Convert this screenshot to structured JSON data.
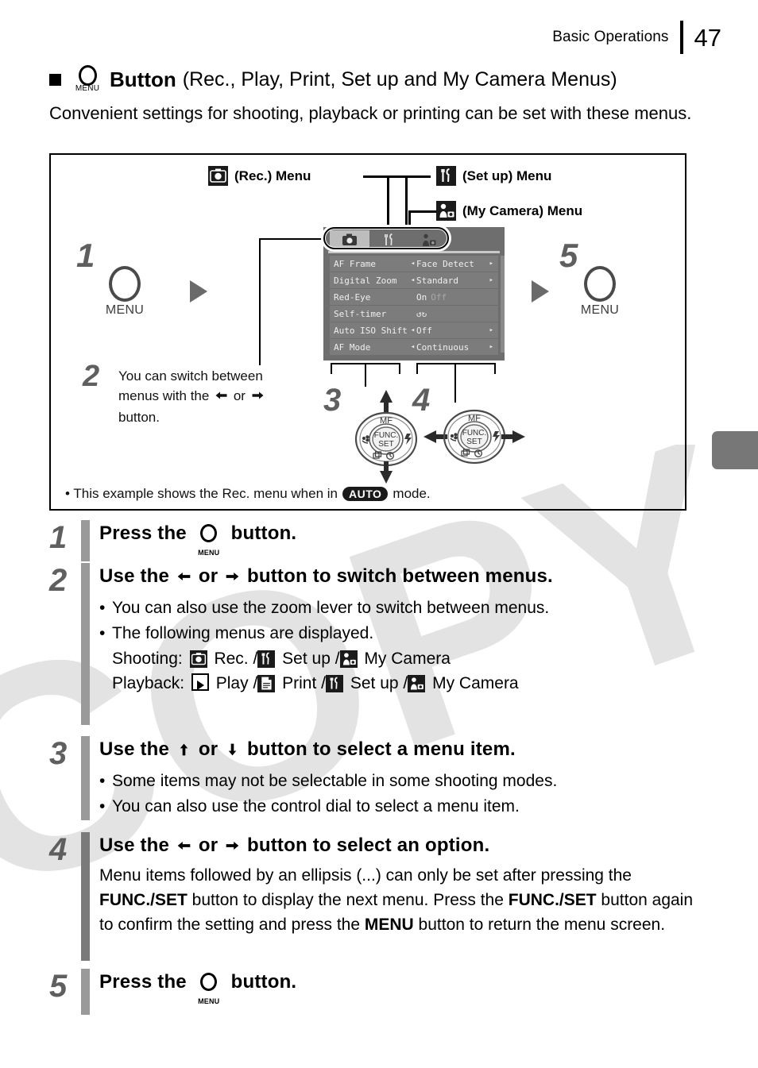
{
  "header": {
    "section_title": "Basic Operations",
    "page_number": "47"
  },
  "section": {
    "bullet_icon": "black-square",
    "button_icon_label": "MENU",
    "title_bold": "Button",
    "title_rest": "(Rec., Play, Print, Set up and My Camera Menus)",
    "lede": "Convenient settings for shooting, playback or printing can be set with these menus."
  },
  "diagram": {
    "callouts": [
      {
        "icon": "rec-camera-icon",
        "label": "(Rec.) Menu"
      },
      {
        "icon": "setup-tools-icon",
        "label": "(Set up) Menu"
      },
      {
        "icon": "my-camera-icon",
        "label": "(My Camera) Menu"
      }
    ],
    "step1_number": "1",
    "step1_button": "MENU",
    "step5_number": "5",
    "step5_button": "MENU",
    "step2_number": "2",
    "step2_text_line1": "You can switch between",
    "step2_text_line2_a": "menus with the",
    "step2_text_line2_or": "or",
    "step2_text_line3": "button.",
    "step3_number": "3",
    "step4_number": "4",
    "footnote_a": "• This example shows the Rec. menu when in",
    "footnote_badge": "AUTO",
    "footnote_b": "mode.",
    "lcd": {
      "tabs": [
        {
          "name": "rec-tab",
          "selected": true
        },
        {
          "name": "setup-tab",
          "selected": false
        },
        {
          "name": "my-camera-tab",
          "selected": false
        }
      ],
      "rows": [
        {
          "name": "AF Frame",
          "left_arrow": "◂",
          "value": "Face Detect",
          "value_dim": "",
          "right_arrow": "▸"
        },
        {
          "name": "Digital Zoom",
          "left_arrow": "◂",
          "value": "Standard",
          "value_dim": "",
          "right_arrow": "▸"
        },
        {
          "name": "Red-Eye",
          "left_arrow": "",
          "value": "On",
          "value_dim": "Off",
          "right_arrow": ""
        },
        {
          "name": "Self-timer",
          "left_arrow": "",
          "value": "↺↻",
          "value_dim": "",
          "right_arrow": ""
        },
        {
          "name": "Auto ISO Shift",
          "left_arrow": "◂",
          "value": "Off",
          "value_dim": "",
          "right_arrow": "▸"
        },
        {
          "name": "AF Mode",
          "left_arrow": "◂",
          "value": "Continuous",
          "value_dim": "",
          "right_arrow": "▸"
        }
      ]
    },
    "dial": {
      "top_label": "MF",
      "center_line1": "FUNC.",
      "center_line2": "SET"
    }
  },
  "steps": [
    {
      "number": "1",
      "title_a": "Press the",
      "title_icon": "MENU",
      "title_b": "button.",
      "bullets": []
    },
    {
      "number": "2",
      "title_a": "Use the",
      "title_or": "or",
      "title_b": "button to switch between menus.",
      "bullets": [
        "You can also use the zoom lever to switch between menus."
      ],
      "bullet2_head": "The following menus are displayed.",
      "shooting_label": "Shooting:",
      "shooting_items": [
        "Rec.",
        "Set up",
        "My Camera"
      ],
      "playback_label": "Playback:",
      "playback_items": [
        "Play",
        "Print",
        "Set up",
        "My Camera"
      ],
      "separator": "/"
    },
    {
      "number": "3",
      "title_a": "Use the",
      "title_or": "or",
      "title_b": "button to select a menu item.",
      "bullets": [
        "Some items may not be selectable in some shooting modes.",
        "You can also use the control dial to select a menu item."
      ]
    },
    {
      "number": "4",
      "title_a": "Use the",
      "title_or": "or",
      "title_b": "button to select an option.",
      "paragraph_1": "Menu items followed by an ellipsis (...) can only be set after pressing the ",
      "paragraph_bold_1": "FUNC./SET",
      "paragraph_2": " button to display the next menu. Press the ",
      "paragraph_bold_2": "FUNC./SET",
      "paragraph_3": " button again to confirm the setting and press the ",
      "paragraph_bold_3": "MENU",
      "paragraph_4": " button to return the menu screen."
    },
    {
      "number": "5",
      "title_a": "Press the",
      "title_icon": "MENU",
      "title_b": "button."
    }
  ],
  "watermark": {
    "text": "COPY"
  },
  "colors": {
    "step_bar": "#9a9a9a",
    "step_number": "#5f5f5f",
    "lcd_background": "#6e6e6e",
    "lcd_row": "#7c7c7c",
    "lcd_tab_selected": "#bdbdbd",
    "edge_tab": "#777777",
    "ink": "#000000"
  }
}
